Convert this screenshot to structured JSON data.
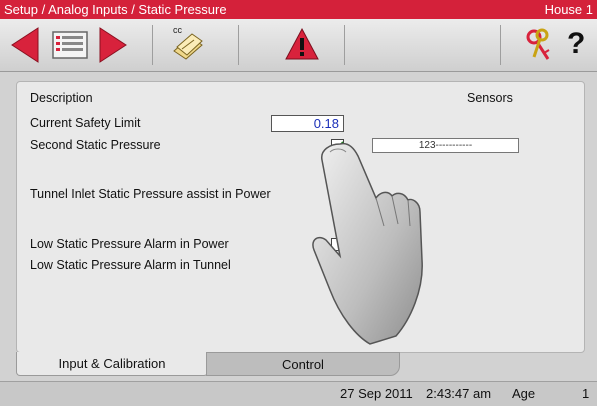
{
  "window": {
    "breadcrumb": "Setup / Analog Inputs / Static Pressure",
    "house": "House 1"
  },
  "toolbar": {
    "back_icon": "left-arrow-icon",
    "menu_icon": "menu-list-icon",
    "forward_icon": "right-arrow-icon",
    "copy_label": "cc",
    "alarm_icon": "warning-icon",
    "keys_icon": "keys-icon",
    "help_label": "?"
  },
  "main": {
    "header_description": "Description",
    "header_sensors": "Sensors",
    "rows": {
      "current_safety_limit": {
        "label": "Current Safety Limit",
        "value": "0.18"
      },
      "second_static_pressure": {
        "label": "Second Static Pressure",
        "checked": true,
        "sensor_value": "123-----------"
      },
      "tunnel_inlet": {
        "label": "Tunnel Inlet Static Pressure assist in Power",
        "checked": true
      },
      "low_power_alarm": {
        "label": "Low Static Pressure Alarm in Power",
        "checked": false
      },
      "low_tunnel_alarm": {
        "label": "Low Static Pressure Alarm in Tunnel",
        "checked": false
      }
    }
  },
  "tabs": [
    {
      "label": "Input & Calibration",
      "active": true
    },
    {
      "label": "Control",
      "active": false
    }
  ],
  "status": {
    "date": "27 Sep 2011",
    "time": "2:43:47 am",
    "age_label": "Age",
    "age_value": "1"
  },
  "colors": {
    "title_bar": "#d4213a",
    "value_text": "#1a2fb8",
    "checkmark": "#1d7a1d"
  }
}
